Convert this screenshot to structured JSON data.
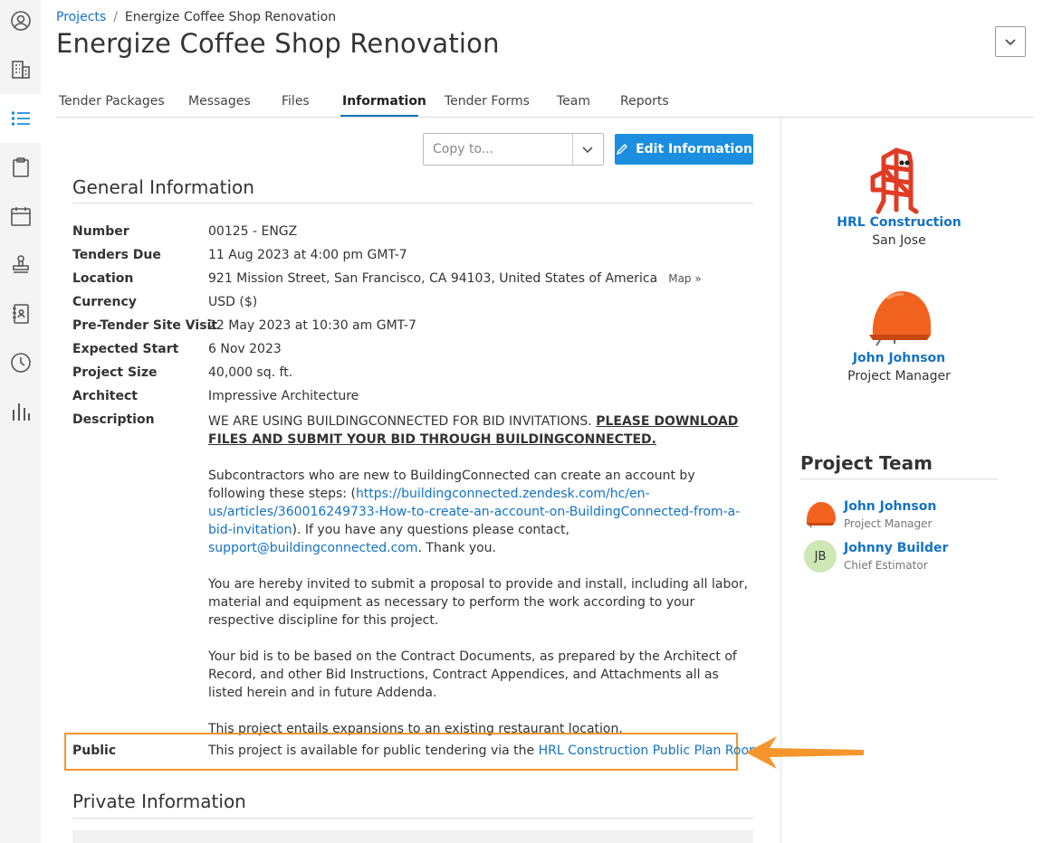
{
  "sidebar": {
    "items": [
      {
        "icon": "user-circle-icon"
      },
      {
        "icon": "building-icon"
      },
      {
        "icon": "list-icon",
        "active": true
      },
      {
        "icon": "clipboard-icon"
      },
      {
        "icon": "calendar-icon"
      },
      {
        "icon": "stamp-icon"
      },
      {
        "icon": "contacts-book-icon"
      },
      {
        "icon": "clock-icon"
      },
      {
        "icon": "bar-chart-icon"
      }
    ]
  },
  "breadcrumb": {
    "root": "Projects",
    "separator": "/",
    "current": "Energize Coffee Shop Renovation"
  },
  "page": {
    "title": "Energize Coffee Shop Renovation"
  },
  "tabs": [
    {
      "label": "Tender Packages"
    },
    {
      "label": "Messages"
    },
    {
      "label": "Files"
    },
    {
      "label": "Information",
      "active": true
    },
    {
      "label": "Tender Forms"
    },
    {
      "label": "Team"
    },
    {
      "label": "Reports"
    }
  ],
  "actions": {
    "copy_placeholder": "Copy to...",
    "edit_label": "Edit Information"
  },
  "general": {
    "heading": "General Information",
    "rows": [
      {
        "label": "Number",
        "value": "00125 - ENGZ"
      },
      {
        "label": "Tenders Due",
        "value": "11 Aug 2023 at 4:00 pm GMT-7"
      },
      {
        "label": "Location",
        "value": "921 Mission Street, San Francisco, CA 94103, United States of America",
        "link": "Map »"
      },
      {
        "label": "Currency",
        "value": "USD ($)"
      },
      {
        "label": "Pre-Tender Site Visit",
        "value": "22 May 2023 at 10:30 am GMT-7"
      },
      {
        "label": "Expected Start",
        "value": "6 Nov 2023"
      },
      {
        "label": "Project Size",
        "value": "40,000 sq. ft."
      },
      {
        "label": "Architect",
        "value": "Impressive Architecture"
      },
      {
        "label": "Description"
      }
    ],
    "description": {
      "p1_text": "WE ARE USING BUILDINGCONNECTED FOR BID INVITATIONS. ",
      "p1_bold": "PLEASE DOWNLOAD FILES AND SUBMIT YOUR BID THROUGH BUILDINGCONNECTED.",
      "p2_a": "Subcontractors who are new to BuildingConnected can create an account by following these steps: (",
      "p2_link": "https://buildingconnected.zendesk.com/hc/en-us/articles/360016249733-How-to-create-an-account-on-BuildingConnected-from-a-bid-invitation",
      "p2_b": "). If you have any questions please contact, ",
      "p2_email": "support@buildingconnected.com",
      "p2_c": ". Thank you.",
      "p3": "You are hereby invited to submit a proposal to provide and install, including all labor, material and equipment as necessary to perform the work according to your respective discipline for this project.",
      "p4": "Your bid is to be based on the Contract Documents, as prepared by the Architect of Record, and other Bid Instructions, Contract Appendices, and Attachments all as listed herein and in future Addenda.",
      "p5": "This project entails expansions to an existing restaurant location."
    },
    "public": {
      "label": "Public",
      "text": "This project is available for public tendering via the ",
      "link": "HRL Construction Public Plan Room"
    }
  },
  "private": {
    "heading": "Private Information"
  },
  "company": {
    "name": "HRL Construction",
    "city": "San Jose"
  },
  "manager": {
    "name": "John Johnson",
    "role": "Project Manager"
  },
  "team": {
    "heading": "Project Team",
    "members": [
      {
        "name": "John Johnson",
        "role": "Project Manager"
      },
      {
        "name": "Johnny Builder",
        "role": "Chief Estimator",
        "initials": "JB"
      }
    ]
  },
  "colors": {
    "accent": "#1372c6",
    "button": "#1b8ee0",
    "highlight": "#f5952b"
  }
}
